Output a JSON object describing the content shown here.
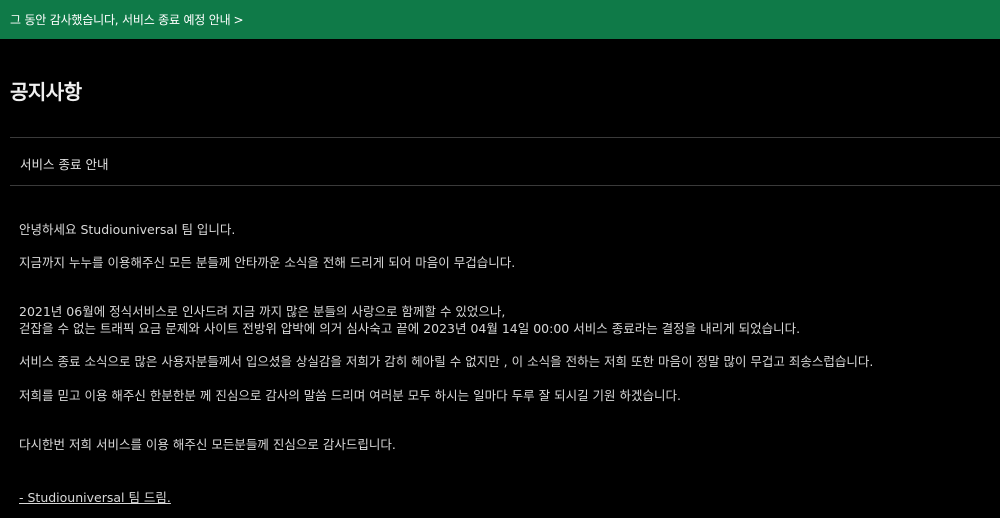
{
  "banner": {
    "text": "그 동안 감사했습니다, 서비스 종료 예정 안내",
    "chevron": ">"
  },
  "page": {
    "title": "공지사항"
  },
  "post": {
    "title": "서비스 종료 안내",
    "lines": [
      "안녕하세요 Studiouniversal 팀 입니다.",
      "지금까지 누누를 이용해주신 모든 분들께 안타까운 소식을 전해 드리게 되어 마음이 무겁습니다.",
      "2021년 06월에 정식서비스로 인사드려 지금 까지 많은 분들의 사랑으로 함께할 수 있었으나,",
      "걷잡을 수 없는 트래픽 요금 문제와 사이트 전방위 압박에 의거 심사숙고 끝에 2023년 04월 14일 00:00 서비스 종료라는 결정을 내리게 되었습니다.",
      "서비스 종료 소식으로 많은 사용자분들께서 입으셨을 상실감을 저희가 감히 헤아릴 수 없지만 , 이 소식을 전하는 저희 또한 마음이 정말 많이 무겁고 죄송스럽습니다.",
      "저희를 믿고 이용 해주신 한분한분 께 진심으로 감사의 말씀 드리며 여러분 모두 하시는 일마다 두루 잘 되시길 기원 하겠습니다.",
      "다시한번 저희 서비스를 이용 해주신 모든분들께 진심으로 감사드립니다."
    ],
    "signature": "- Studiouniversal 팀 드림."
  }
}
